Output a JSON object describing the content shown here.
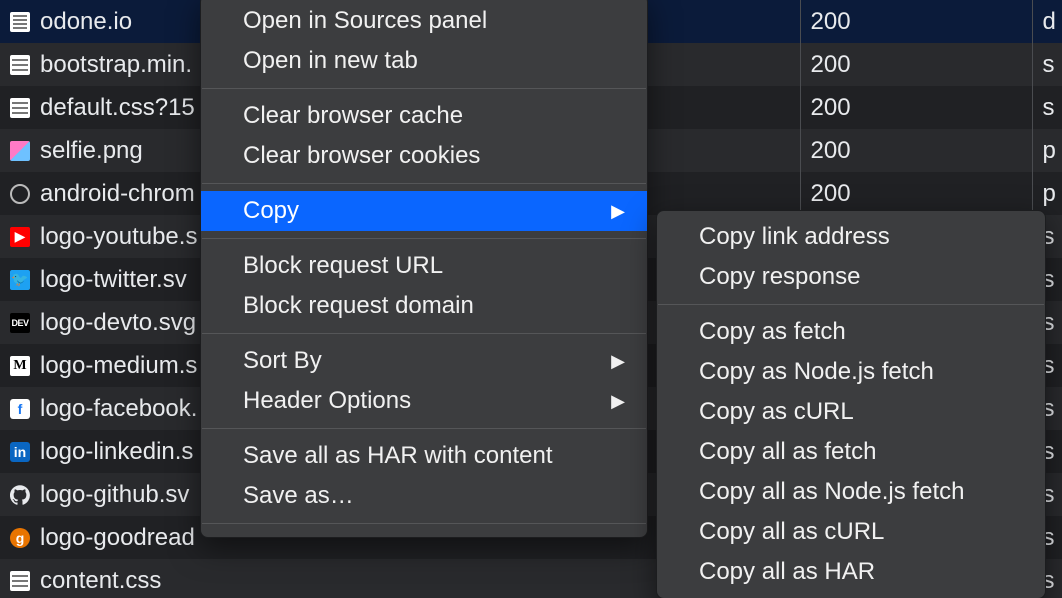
{
  "rows": [
    {
      "name": "odone.io",
      "icon": "doc",
      "status": "200",
      "extra": "d",
      "sel": true
    },
    {
      "name": "bootstrap.min.",
      "icon": "css",
      "status": "200",
      "extra": "s",
      "sel": false
    },
    {
      "name": "default.css?15",
      "icon": "css",
      "status": "200",
      "extra": "s",
      "sel": false
    },
    {
      "name": "selfie.png",
      "icon": "img",
      "status": "200",
      "extra": "p",
      "sel": false
    },
    {
      "name": "android-chrom",
      "icon": "ring",
      "status": "200",
      "extra": "p",
      "sel": false
    },
    {
      "name": "logo-youtube.s",
      "icon": "yt",
      "status": "",
      "extra": "s",
      "sel": false
    },
    {
      "name": "logo-twitter.sv",
      "icon": "tw",
      "status": "",
      "extra": "s",
      "sel": false
    },
    {
      "name": "logo-devto.svg",
      "icon": "dev",
      "status": "",
      "extra": "s",
      "sel": false
    },
    {
      "name": "logo-medium.s",
      "icon": "md",
      "status": "",
      "extra": "s",
      "sel": false
    },
    {
      "name": "logo-facebook.",
      "icon": "fb",
      "status": "",
      "extra": "s",
      "sel": false
    },
    {
      "name": "logo-linkedin.s",
      "icon": "li",
      "status": "",
      "extra": "s",
      "sel": false
    },
    {
      "name": "logo-github.sv",
      "icon": "gh",
      "status": "",
      "extra": "s",
      "sel": false
    },
    {
      "name": "logo-goodread",
      "icon": "gr",
      "status": "",
      "extra": "s",
      "sel": false
    },
    {
      "name": "content.css",
      "icon": "css",
      "status": "",
      "extra": "s",
      "sel": false
    }
  ],
  "menu1": {
    "open_sources": "Open in Sources panel",
    "open_tab": "Open in new tab",
    "clear_cache": "Clear browser cache",
    "clear_cookies": "Clear browser cookies",
    "copy": "Copy",
    "block_url": "Block request URL",
    "block_domain": "Block request domain",
    "sort_by": "Sort By",
    "header_opts": "Header Options",
    "save_har": "Save all as HAR with content",
    "save_as": "Save as…"
  },
  "menu2": {
    "copy_link": "Copy link address",
    "copy_response": "Copy response",
    "copy_fetch": "Copy as fetch",
    "copy_node_fetch": "Copy as Node.js fetch",
    "copy_curl": "Copy as cURL",
    "copy_all_fetch": "Copy all as fetch",
    "copy_all_node": "Copy all as Node.js fetch",
    "copy_all_curl": "Copy all as cURL",
    "copy_all_har": "Copy all as HAR"
  },
  "icons": {
    "yt": "▶",
    "tw": "🐦",
    "dev": "DEV",
    "md": "M",
    "fb": "f",
    "li": "in",
    "gr": "g"
  }
}
